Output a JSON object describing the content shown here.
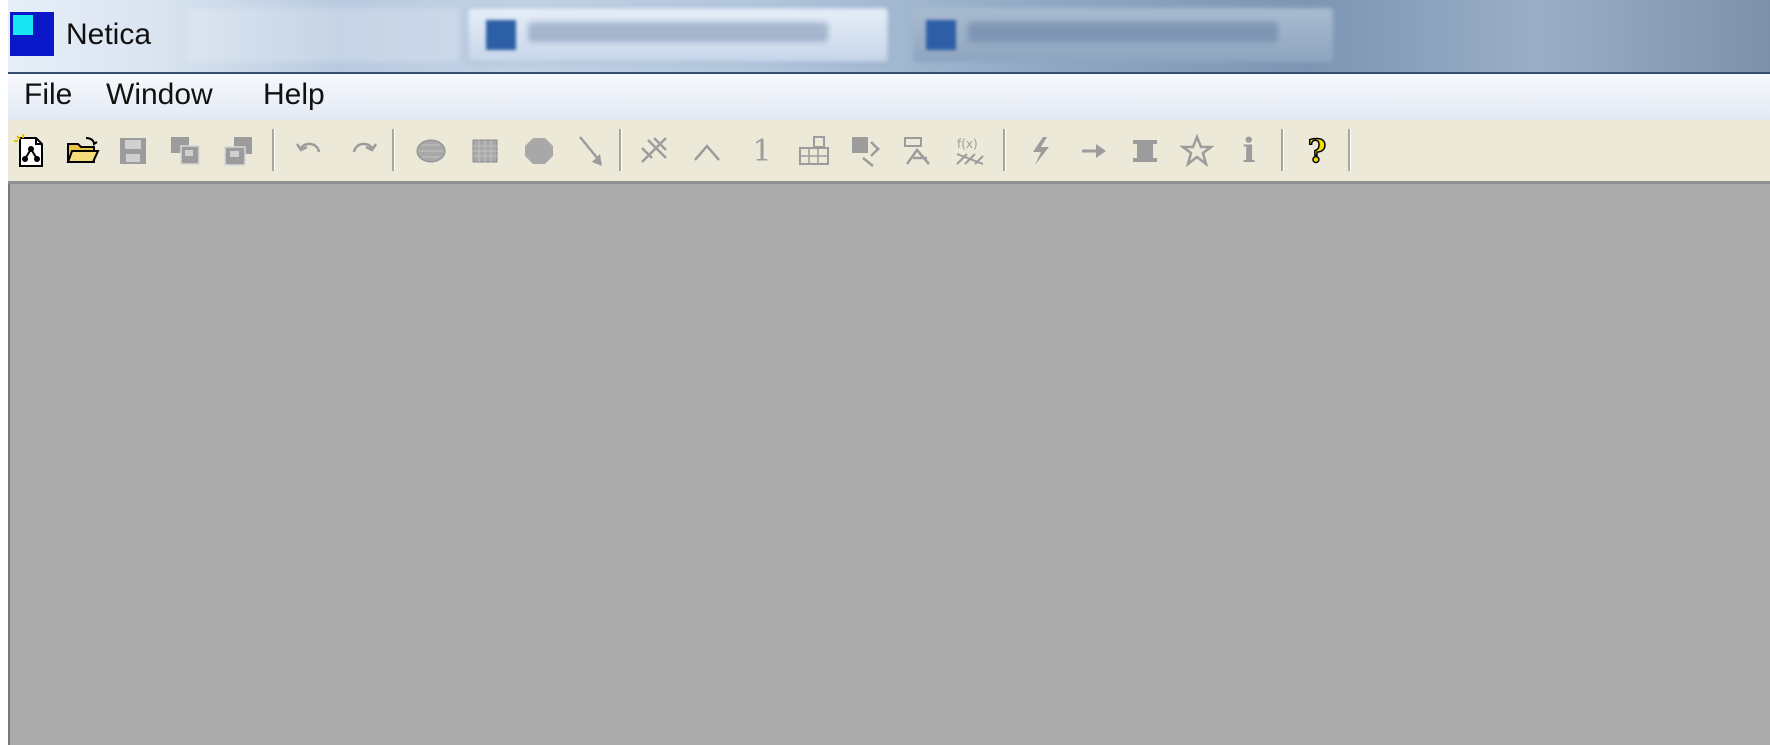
{
  "window": {
    "title": "Netica"
  },
  "menu": {
    "items": [
      "File",
      "Window",
      "Help"
    ]
  },
  "toolbar": {
    "buttons": [
      {
        "name": "new-network-icon",
        "enabled": true
      },
      {
        "name": "open-folder-icon",
        "enabled": true
      },
      {
        "name": "save-icon",
        "enabled": false
      },
      {
        "name": "duplicate-icon",
        "enabled": false
      },
      {
        "name": "paste-icon",
        "enabled": false
      },
      {
        "name": "undo-icon",
        "enabled": false
      },
      {
        "name": "redo-icon",
        "enabled": false
      },
      {
        "name": "nature-node-icon",
        "enabled": false
      },
      {
        "name": "decision-node-icon",
        "enabled": false
      },
      {
        "name": "utility-node-icon",
        "enabled": false
      },
      {
        "name": "add-link-icon",
        "enabled": false
      },
      {
        "name": "remove-links-icon",
        "enabled": false
      },
      {
        "name": "caret-icon",
        "enabled": false
      },
      {
        "name": "number-one-icon",
        "enabled": false,
        "glyph": "1"
      },
      {
        "name": "table-icon",
        "enabled": false
      },
      {
        "name": "absorb-nodes-icon",
        "enabled": false
      },
      {
        "name": "reverse-link-icon",
        "enabled": false
      },
      {
        "name": "equation-icon",
        "enabled": false
      },
      {
        "name": "compile-icon",
        "enabled": false
      },
      {
        "name": "arrow-right-icon",
        "enabled": false
      },
      {
        "name": "clear-findings-icon",
        "enabled": false
      },
      {
        "name": "optimize-icon",
        "enabled": false
      },
      {
        "name": "info-icon",
        "enabled": false,
        "glyph": "i"
      },
      {
        "name": "help-icon",
        "enabled": true,
        "glyph": "?"
      }
    ]
  },
  "colors": {
    "toolbar_bg": "#ece9d8",
    "client_bg": "#ababab",
    "icon_disabled": "#9c9c9c",
    "app_icon_blue": "#0a17c8",
    "app_icon_cyan": "#18e6f2"
  }
}
